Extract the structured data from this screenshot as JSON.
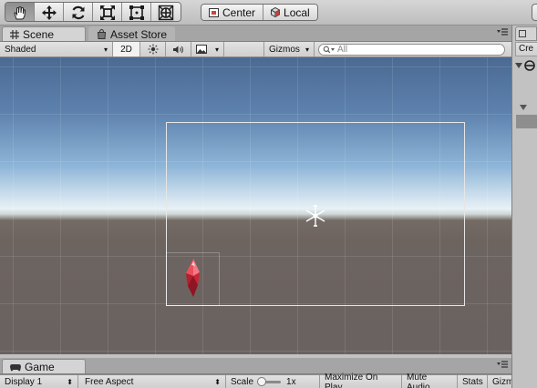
{
  "toolbar": {
    "tools": [
      {
        "name": "hand-tool-icon",
        "active": true
      },
      {
        "name": "move-tool-icon",
        "active": false
      },
      {
        "name": "rotate-tool-icon",
        "active": false
      },
      {
        "name": "scale-tool-icon",
        "active": false
      },
      {
        "name": "rect-tool-icon",
        "active": false
      },
      {
        "name": "transform-tool-icon",
        "active": false
      }
    ],
    "pivot_label": "Center",
    "space_label": "Local"
  },
  "scene_tabs": {
    "scene": "Scene",
    "asset_store": "Asset Store"
  },
  "scene_controls": {
    "shading_mode": "Shaded",
    "mode_2d": "2D",
    "gizmos": "Gizmos",
    "search_placeholder": "All"
  },
  "right_panel": {
    "create_label": "Cre"
  },
  "game_tab": {
    "label": "Game",
    "display": "Display 1",
    "aspect": "Free Aspect",
    "scale_label": "Scale",
    "scale_value": "1x",
    "maximize": "Maximize On Play",
    "mute": "Mute Audio",
    "stats": "Stats",
    "gizmos": "Gizm"
  },
  "colors": {
    "sky_top": "#4b6a93",
    "horizon": "#e8f1f6",
    "ground": "#6d6460",
    "crystal": "#e0283a",
    "camera_frame": "#e6e6e6"
  }
}
